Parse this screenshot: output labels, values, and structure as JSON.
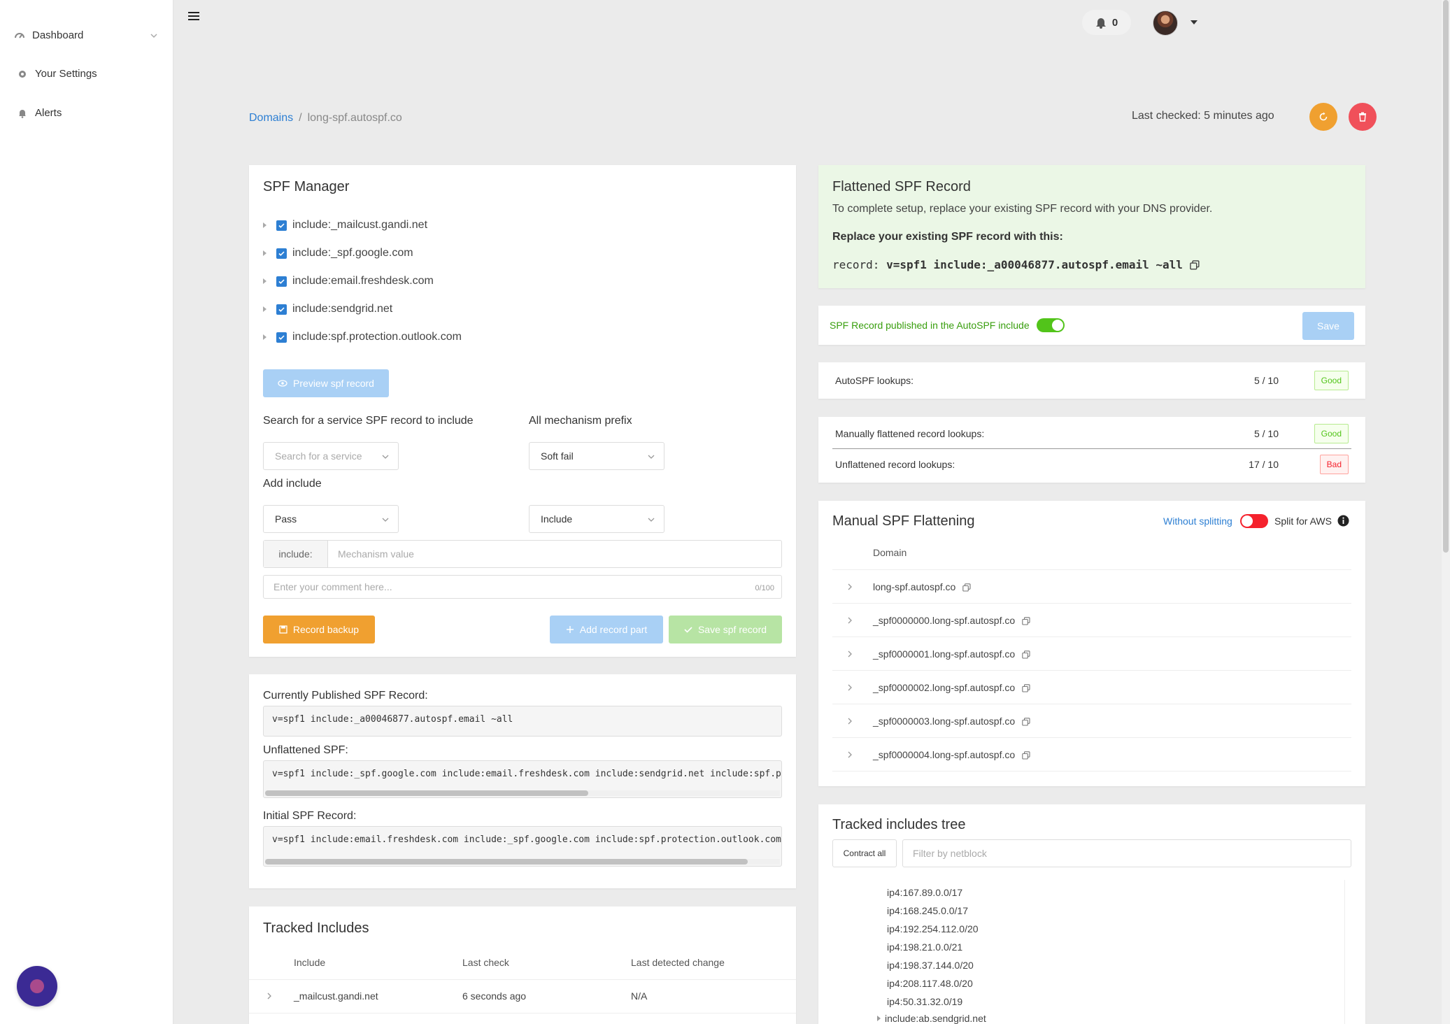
{
  "sidebar": {
    "items": [
      {
        "label": "Dashboard",
        "icon": "dashboard-icon"
      },
      {
        "label": "Your Settings",
        "icon": "gear-icon"
      },
      {
        "label": "Alerts",
        "icon": "bell-icon"
      }
    ]
  },
  "topbar": {
    "notifications_count": "0"
  },
  "breadcrumb": {
    "root": "Domains",
    "separator": "/",
    "current": "long-spf.autospf.co"
  },
  "header": {
    "last_checked": "Last checked: 5 minutes ago"
  },
  "colors": {
    "primary": "#2d7fd3",
    "warning": "#f0a030",
    "danger": "#f0505a",
    "success": "#52c41a",
    "light_blue": "#a9d0f5",
    "light_green": "#b7e4a4",
    "flattened_bg": "#ebf7e6",
    "toggle_on": "#52c41a",
    "toggle_off": "#f5222d"
  },
  "spf_manager": {
    "title": "SPF Manager",
    "includes": [
      "include:_mailcust.gandi.net",
      "include:_spf.google.com",
      "include:email.freshdesk.com",
      "include:sendgrid.net",
      "include:spf.protection.outlook.com"
    ],
    "preview_button": "Preview spf record",
    "search_label": "Search for a service SPF record to include",
    "search_placeholder": "Search for a service",
    "prefix_label": "All mechanism prefix",
    "prefix_value": "Soft fail",
    "add_include_label": "Add include",
    "qualifier_value": "Pass",
    "mechanism_type_value": "Include",
    "mechanism_addon": "include:",
    "mechanism_placeholder": "Mechanism value",
    "comment_placeholder": "Enter your comment here...",
    "comment_count": "0/100",
    "backup_button": "Record backup",
    "add_part_button": "Add record part",
    "save_button": "Save spf record"
  },
  "records": {
    "published_label": "Currently Published SPF Record:",
    "published_value": "v=spf1 include:_a00046877.autospf.email ~all",
    "unflattened_label": "Unflattened SPF:",
    "unflattened_value": "v=spf1 include:_spf.google.com include:email.freshdesk.com include:sendgrid.net include:spf.p",
    "initial_label": "Initial SPF Record:",
    "initial_value": "v=spf1 include:email.freshdesk.com include:_spf.google.com include:spf.protection.outlook.com"
  },
  "tracked_includes": {
    "title": "Tracked Includes",
    "headers": [
      "Include",
      "Last check",
      "Last detected change"
    ],
    "rows": [
      {
        "include": "_mailcust.gandi.net",
        "last_check": "6 seconds ago",
        "last_change": "N/A"
      }
    ]
  },
  "flattened": {
    "title": "Flattened SPF Record",
    "description": "To complete setup, replace your existing SPF record with your DNS provider.",
    "replace_label": "Replace your existing SPF record with this:",
    "record_prefix": "record: ",
    "record_value": "v=spf1 include:_a00046877.autospf.email ~all"
  },
  "publish": {
    "label": "SPF Record published in the AutoSPF include",
    "save": "Save",
    "enabled": true
  },
  "lookups": {
    "autospf": {
      "label": "AutoSPF lookups:",
      "value": "5 / 10",
      "status": "Good"
    },
    "manual": {
      "label": "Manually flattened record lookups:",
      "value": "5 / 10",
      "status": "Good"
    },
    "unflattened": {
      "label": "Unflattened record lookups:",
      "value": "17 / 10",
      "status": "Bad"
    }
  },
  "manual_flattening": {
    "title": "Manual SPF Flattening",
    "without_splitting": "Without splitting",
    "split_aws": "Split for AWS",
    "split_enabled": false,
    "column": "Domain",
    "domains": [
      "long-spf.autospf.co",
      "_spf0000000.long-spf.autospf.co",
      "_spf0000001.long-spf.autospf.co",
      "_spf0000002.long-spf.autospf.co",
      "_spf0000003.long-spf.autospf.co",
      "_spf0000004.long-spf.autospf.co"
    ]
  },
  "tree": {
    "title": "Tracked includes tree",
    "contract_button": "Contract all",
    "filter_placeholder": "Filter by netblock",
    "entries": [
      "ip4:167.89.0.0/17",
      "ip4:168.245.0.0/17",
      "ip4:192.254.112.0/20",
      "ip4:198.21.0.0/21",
      "ip4:198.37.144.0/20",
      "ip4:208.117.48.0/20",
      "ip4:50.31.32.0/19"
    ],
    "sub_include": "include:ab.sendgrid.net"
  }
}
